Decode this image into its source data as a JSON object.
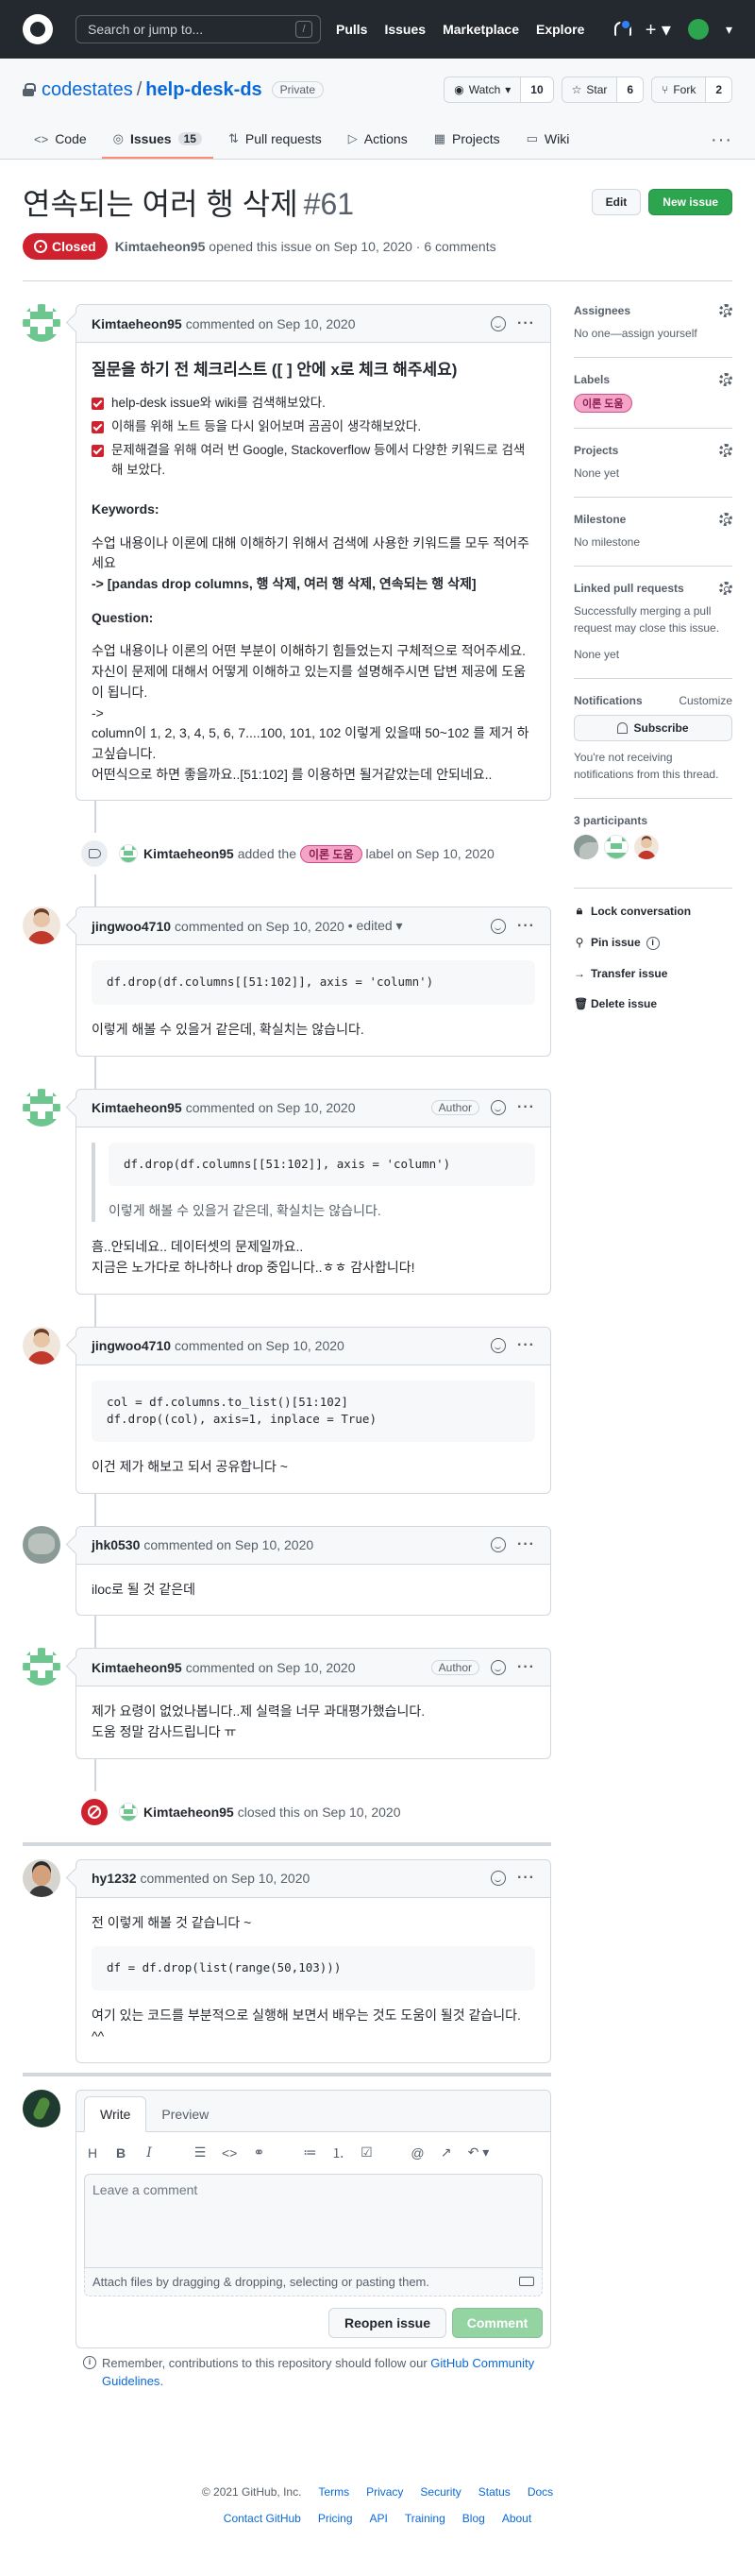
{
  "header": {
    "search_placeholder": "Search or jump to...",
    "search_shortcut": "/",
    "nav": [
      "Pulls",
      "Issues",
      "Marketplace",
      "Explore"
    ]
  },
  "repo": {
    "owner": "codestates",
    "separator": "/",
    "name": "help-desk-ds",
    "visibility": "Private",
    "watch_label": "Watch",
    "watch_count": "10",
    "star_label": "Star",
    "star_count": "6",
    "fork_label": "Fork",
    "fork_count": "2",
    "tabs": [
      {
        "label": "Code",
        "icon": "code-icon"
      },
      {
        "label": "Issues",
        "icon": "issue-icon",
        "count": "15"
      },
      {
        "label": "Pull requests",
        "icon": "pull-request-icon"
      },
      {
        "label": "Actions",
        "icon": "play-icon"
      },
      {
        "label": "Projects",
        "icon": "project-icon"
      },
      {
        "label": "Wiki",
        "icon": "book-icon"
      }
    ],
    "more": "···"
  },
  "issue": {
    "title": "연속되는 여러 행 삭제",
    "number": "#61",
    "edit_label": "Edit",
    "new_issue_label": "New issue",
    "state": "Closed",
    "author": "Kimtaeheon95",
    "meta": "opened this issue on Sep 10, 2020 · 6 comments"
  },
  "first_comment": {
    "author": "Kimtaeheon95",
    "time": "commented on Sep 10, 2020",
    "heading": "질문을 하기 전 체크리스트 ([ ] 안에 x로 체크 해주세요)",
    "checklist": [
      "help-desk issue와 wiki를 검색해보았다.",
      "이해를 위해 노트 등을 다시 읽어보며 곰곰이 생각해보았다.",
      "문제해결을 위해 여러 번 Google, Stackoverflow 등에서 다양한 키워드로 검색해 보았다."
    ],
    "keywords_title": "Keywords:",
    "keywords_desc": "수업 내용이나 이론에 대해 이해하기 위해서 검색에 사용한 키워드를 모두 적어주세요",
    "keywords_value": "-> [pandas drop columns, 행 삭제, 여러 행 삭제, 연속되는 행 삭제]",
    "question_title": "Question:",
    "question_lines": [
      "수업 내용이나 이론의 어떤 부분이 이해하기 힘들었는지 구체적으로 적어주세요. 자신이 문제에 대해서 어떻게 이해하고 있는지를 설명해주시면 답변 제공에 도움이 됩니다.",
      "->",
      "column이 1, 2, 3, 4, 5, 6, 7....100, 101, 102 이렇게 있을때 50~102 를 제거 하고싶습니다.",
      "어떤식으로 하면 좋을까요..[51:102] 를 이용하면 될거같았는데 안되네요.."
    ]
  },
  "label_event": {
    "author": "Kimtaeheon95",
    "text_before": "added the",
    "label": "이론 도움",
    "text_after": "label on Sep 10, 2020"
  },
  "comments": [
    {
      "author": "jingwoo4710",
      "time": "commented on Sep 10, 2020",
      "edited": "• edited ▾",
      "code": "df.drop(df.columns[[51:102]], axis = 'column')",
      "text": "이렇게 해볼 수 있을거 같은데, 확실치는 않습니다."
    },
    {
      "author": "Kimtaeheon95",
      "time": "commented on Sep 10, 2020",
      "badge": "Author",
      "quote_code": "df.drop(df.columns[[51:102]], axis = 'column')",
      "quote_text": "이렇게 해볼 수 있을거 같은데, 확실치는 않습니다.",
      "line1": "흠..안되네요.. 데이터셋의 문제일까요..",
      "line2": "지금은 노가다로 하나하나 drop 중입니다..ㅎㅎ 감사합니다!"
    },
    {
      "author": "jingwoo4710",
      "time": "commented on Sep 10, 2020",
      "code_line1": "col = df.columns.to_list()[51:102]",
      "code_line2": "df.drop((col), axis=1, inplace = True)",
      "text": "이건 제가 해보고 되서 공유합니다 ~"
    },
    {
      "author": "jhk0530",
      "time": "commented on Sep 10, 2020",
      "text": "iloc로 될 것 같은데"
    },
    {
      "author": "Kimtaeheon95",
      "time": "commented on Sep 10, 2020",
      "badge": "Author",
      "line1": "제가 요령이 없었나봅니다..제 실력을 너무 과대평가했습니다.",
      "line2": "도움 정말 감사드립니다 ㅠ"
    }
  ],
  "close_event": {
    "author": "Kimtaeheon95",
    "text": "closed this on Sep 10, 2020"
  },
  "last_comment": {
    "author": "hy1232",
    "time": "commented on Sep 10, 2020",
    "text1": "전 이렇게 해볼 것 같습니다 ~",
    "code": "df = df.drop(list(range(50,103)))",
    "text2": "여기 있는 코드를 부분적으로 실행해 보면서 배우는 것도 도움이 될것 같습니다. ^^"
  },
  "composer": {
    "tab_write": "Write",
    "tab_preview": "Preview",
    "placeholder": "Leave a comment",
    "attach_text": "Attach files by dragging & dropping, selecting or pasting them.",
    "reopen_label": "Reopen issue",
    "comment_label": "Comment",
    "guidelines_prefix": "Remember, contributions to this repository should follow our",
    "guidelines_link": "GitHub Community Guidelines",
    "guidelines_suffix": "."
  },
  "sidebar": {
    "assignees_title": "Assignees",
    "assignees_value": "No one—assign yourself",
    "labels_title": "Labels",
    "labels_value": "이론 도움",
    "projects_title": "Projects",
    "projects_value": "None yet",
    "milestone_title": "Milestone",
    "milestone_value": "No milestone",
    "linked_title": "Linked pull requests",
    "linked_desc": "Successfully merging a pull request may close this issue.",
    "linked_value": "None yet",
    "notifications_title": "Notifications",
    "customize": "Customize",
    "subscribe_label": "Subscribe",
    "notif_desc": "You're not receiving notifications from this thread.",
    "participants_title": "3 participants",
    "lock": "Lock conversation",
    "pin": "Pin issue",
    "transfer": "Transfer issue",
    "delete": "Delete issue"
  },
  "footer": {
    "copyright": "© 2021 GitHub, Inc.",
    "row1": [
      "Terms",
      "Privacy",
      "Security",
      "Status",
      "Docs"
    ],
    "row2": [
      "Contact GitHub",
      "Pricing",
      "API",
      "Training",
      "Blog",
      "About"
    ]
  },
  "colors": {
    "closed": "#cf222e",
    "green": "#2da44e",
    "link": "#0969da",
    "label_bg": "#f5a3c7"
  }
}
